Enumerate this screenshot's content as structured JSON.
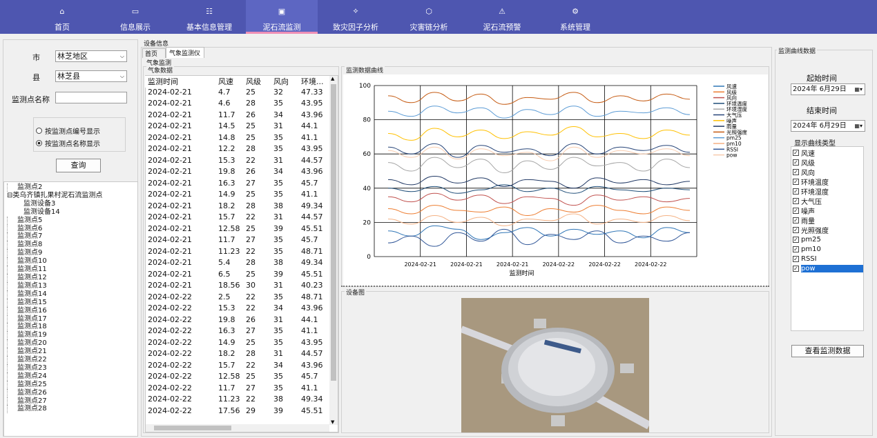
{
  "nav": [
    {
      "label": "首页",
      "icon": "home-icon"
    },
    {
      "label": "信息展示",
      "icon": "info-display-icon"
    },
    {
      "label": "基本信息管理",
      "icon": "basic-info-icon"
    },
    {
      "label": "泥石流监测",
      "icon": "monitor-icon"
    },
    {
      "label": "致灾因子分析",
      "icon": "factor-icon"
    },
    {
      "label": "灾害链分析",
      "icon": "chain-icon"
    },
    {
      "label": "泥石流预警",
      "icon": "warning-icon"
    },
    {
      "label": "系统管理",
      "icon": "gear-icon"
    }
  ],
  "left": {
    "city_label": "市",
    "city_value": "林芝地区",
    "county_label": "县",
    "county_value": "林芝县",
    "point_label": "监测点名称",
    "point_value": "",
    "radio1": "按监测点编号显示",
    "radio2": "按监测点名称显示",
    "query_btn": "查询",
    "tree": [
      "监测点2",
      "类乌齐镇扎果村泥石流监测点",
      "监测设备3",
      "监测设备14",
      "监测点5",
      "监测点6",
      "监测点7",
      "监测点8",
      "监测点9",
      "监测点10",
      "监测点11",
      "监测点12",
      "监测点13",
      "监测点14",
      "监测点15",
      "监测点16",
      "监测点17",
      "监测点18",
      "监测点19",
      "监测点20",
      "监测点21",
      "监测点22",
      "监测点23",
      "监测点24",
      "监测点25",
      "监测点26",
      "监测点27",
      "监测点28"
    ]
  },
  "center": {
    "device_info": "设备信息",
    "tab_home": "首页",
    "tab_weather": "气象监测仪",
    "weather_monitor": "气象监测",
    "weather_data": "气象数据",
    "curve_title": "监测数据曲线",
    "device_img_title": "设备图",
    "columns": [
      "监测时间",
      "风速",
      "风级",
      "风向",
      "环境..."
    ],
    "rows": [
      [
        "2024-02-21",
        "4.7",
        "25",
        "32",
        "47.33"
      ],
      [
        "2024-02-21",
        "4.6",
        "28",
        "35",
        "43.95"
      ],
      [
        "2024-02-21",
        "11.7",
        "26",
        "34",
        "43.96"
      ],
      [
        "2024-02-21",
        "14.5",
        "25",
        "31",
        "44.1"
      ],
      [
        "2024-02-21",
        "14.8",
        "25",
        "35",
        "41.1"
      ],
      [
        "2024-02-21",
        "12.2",
        "28",
        "35",
        "43.95"
      ],
      [
        "2024-02-21",
        "15.3",
        "22",
        "31",
        "44.57"
      ],
      [
        "2024-02-21",
        "19.8",
        "26",
        "34",
        "43.96"
      ],
      [
        "2024-02-21",
        "16.3",
        "27",
        "35",
        "45.7"
      ],
      [
        "2024-02-21",
        "14.9",
        "25",
        "35",
        "41.1"
      ],
      [
        "2024-02-21",
        "18.2",
        "28",
        "38",
        "49.34"
      ],
      [
        "2024-02-21",
        "15.7",
        "22",
        "31",
        "44.57"
      ],
      [
        "2024-02-21",
        "12.58",
        "25",
        "39",
        "45.51"
      ],
      [
        "2024-02-21",
        "11.7",
        "27",
        "35",
        "45.7"
      ],
      [
        "2024-02-21",
        "11.23",
        "22",
        "35",
        "48.71"
      ],
      [
        "2024-02-21",
        "5.4",
        "28",
        "38",
        "49.34"
      ],
      [
        "2024-02-21",
        "6.5",
        "25",
        "39",
        "45.51"
      ],
      [
        "2024-02-21",
        "18.56",
        "30",
        "31",
        "40.23"
      ],
      [
        "2024-02-22",
        "2.5",
        "22",
        "35",
        "48.71"
      ],
      [
        "2024-02-22",
        "15.3",
        "22",
        "34",
        "43.96"
      ],
      [
        "2024-02-22",
        "19.8",
        "26",
        "31",
        "44.1"
      ],
      [
        "2024-02-22",
        "16.3",
        "27",
        "35",
        "41.1"
      ],
      [
        "2024-02-22",
        "14.9",
        "25",
        "35",
        "43.95"
      ],
      [
        "2024-02-22",
        "18.2",
        "28",
        "31",
        "44.57"
      ],
      [
        "2024-02-22",
        "15.7",
        "22",
        "34",
        "43.96"
      ],
      [
        "2024-02-22",
        "12.58",
        "25",
        "35",
        "45.7"
      ],
      [
        "2024-02-22",
        "11.7",
        "27",
        "35",
        "41.1"
      ],
      [
        "2024-02-22",
        "11.23",
        "22",
        "38",
        "49.34"
      ],
      [
        "2024-02-22",
        "17.56",
        "29",
        "39",
        "45.51"
      ]
    ]
  },
  "chart_data": {
    "type": "line",
    "xlabel": "监测时间",
    "ylim": [
      0,
      100
    ],
    "yticks": [
      0,
      20,
      40,
      60,
      80,
      100
    ],
    "xticks": [
      "2024-02-21",
      "2024-02-21",
      "2024-02-21",
      "2024-02-22",
      "2024-02-22",
      "2024-02-22"
    ],
    "series": [
      {
        "name": "风速",
        "color": "#2e75b6",
        "values": [
          15,
          12,
          18,
          16,
          10,
          14,
          17,
          12,
          16,
          13,
          15,
          11,
          17,
          14
        ]
      },
      {
        "name": "风级",
        "color": "#ed7d31",
        "values": [
          28,
          25,
          30,
          27,
          26,
          29,
          24,
          28,
          26,
          30,
          27,
          25,
          29,
          27
        ]
      },
      {
        "name": "风向",
        "color": "#c0504d",
        "values": [
          35,
          32,
          37,
          33,
          36,
          31,
          35,
          34,
          30,
          36,
          33,
          35,
          32,
          34
        ]
      },
      {
        "name": "环境温度",
        "color": "#1f4e79",
        "values": [
          40,
          38,
          41,
          37,
          39,
          42,
          38,
          40,
          37,
          41,
          39,
          38,
          40,
          39
        ]
      },
      {
        "name": "环境湿度",
        "color": "#a5a5a5",
        "values": [
          55,
          50,
          58,
          52,
          57,
          49,
          56,
          51,
          58,
          53,
          55,
          50,
          57,
          52
        ]
      },
      {
        "name": "大气压",
        "color": "#264478",
        "values": [
          64,
          60,
          66,
          58,
          65,
          61,
          63,
          59,
          66,
          60,
          64,
          62,
          65,
          61
        ]
      },
      {
        "name": "噪声",
        "color": "#ffc000",
        "values": [
          72,
          68,
          75,
          70,
          74,
          69,
          73,
          71,
          76,
          70,
          72,
          69,
          74,
          71
        ]
      },
      {
        "name": "雨量",
        "color": "#203864",
        "values": [
          45,
          42,
          47,
          43,
          46,
          41,
          45,
          44,
          40,
          46,
          43,
          45,
          42,
          44
        ]
      },
      {
        "name": "光照强度",
        "color": "#c55a11",
        "values": [
          94,
          90,
          96,
          91,
          95,
          89,
          93,
          92,
          96,
          90,
          94,
          91,
          95,
          92
        ]
      },
      {
        "name": "pm25",
        "color": "#5b9bd5",
        "values": [
          85,
          82,
          88,
          84,
          87,
          81,
          86,
          83,
          88,
          82,
          85,
          84,
          87,
          83
        ]
      },
      {
        "name": "pm10",
        "color": "#f4b183",
        "values": [
          22,
          19,
          24,
          20,
          23,
          18,
          22,
          21,
          25,
          19,
          22,
          20,
          24,
          21
        ]
      },
      {
        "name": "RSSI",
        "color": "#2f5597",
        "values": [
          8,
          12,
          6,
          14,
          9,
          16,
          7,
          13,
          10,
          15,
          8,
          12,
          9,
          14
        ]
      },
      {
        "name": "pow",
        "color": "#f8cbad",
        "values": [
          62,
          58,
          64,
          57,
          63,
          59,
          61,
          56,
          64,
          58,
          62,
          60,
          63,
          59
        ]
      }
    ]
  },
  "right": {
    "group_title": "监测曲线数据",
    "start_label": "起始时间",
    "start_value": "2024年 6月29日",
    "end_label": "结束时间",
    "end_value": "2024年 6月29日",
    "curve_type_title": "显示曲线类型",
    "curve_types": [
      "风速",
      "风级",
      "风向",
      "环境温度",
      "环境湿度",
      "大气压",
      "噪声",
      "雨量",
      "光照强度",
      "pm25",
      "pm10",
      "RSSI",
      "pow"
    ],
    "view_btn": "查看监测数据"
  }
}
